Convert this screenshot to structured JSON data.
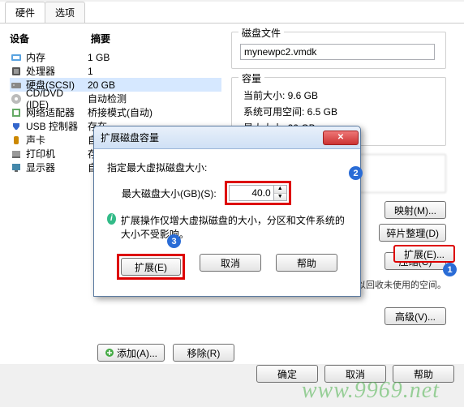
{
  "tabs": {
    "hardware": "硬件",
    "options": "选项"
  },
  "columns": {
    "device": "设备",
    "summary": "摘要"
  },
  "devices": [
    {
      "name": "内存",
      "summary": "1 GB"
    },
    {
      "name": "处理器",
      "summary": "1"
    },
    {
      "name": "硬盘(SCSI)",
      "summary": "20 GB"
    },
    {
      "name": "CD/DVD (IDE)",
      "summary": "自动检测"
    },
    {
      "name": "网络适配器",
      "summary": "桥接模式(自动)"
    },
    {
      "name": "USB 控制器",
      "summary": "存在"
    },
    {
      "name": "声卡",
      "summary": "自动检测"
    },
    {
      "name": "打印机",
      "summary": "存在"
    },
    {
      "name": "显示器",
      "summary": "自动检测"
    }
  ],
  "diskfile": {
    "title": "磁盘文件",
    "value": "mynewpc2.vmdk"
  },
  "capacity": {
    "title": "容量",
    "current": "当前大小: 9.6 GB",
    "free": "系统可用空间: 6.5 GB",
    "max": "最大大小: 20 GB"
  },
  "utilities": {
    "map": "映射(M)...",
    "defrag": "碎片整理(D)",
    "extend": "扩展(E)...",
    "compress": "压缩(C)",
    "advanced": "高级(V)...",
    "compress_hint": "压缩磁盘以回收未使用的空间。"
  },
  "hw_btns": {
    "add": "添加(A)...",
    "remove": "移除(R)"
  },
  "footer": {
    "ok": "确定",
    "cancel": "取消",
    "help": "帮助"
  },
  "dialog": {
    "title": "扩展磁盘容量",
    "label_spec": "指定最大虚拟磁盘大小:",
    "label_size": "最大磁盘大小(GB)(S):",
    "value": "40.0",
    "info": "扩展操作仅增大虚拟磁盘的大小，分区和文件系统的大小不受影响。",
    "extend": "扩展(E)",
    "cancel": "取消",
    "help": "帮助"
  },
  "badges": {
    "n1": "1",
    "n2": "2",
    "n3": "3"
  },
  "watermark": "www.9969.net"
}
